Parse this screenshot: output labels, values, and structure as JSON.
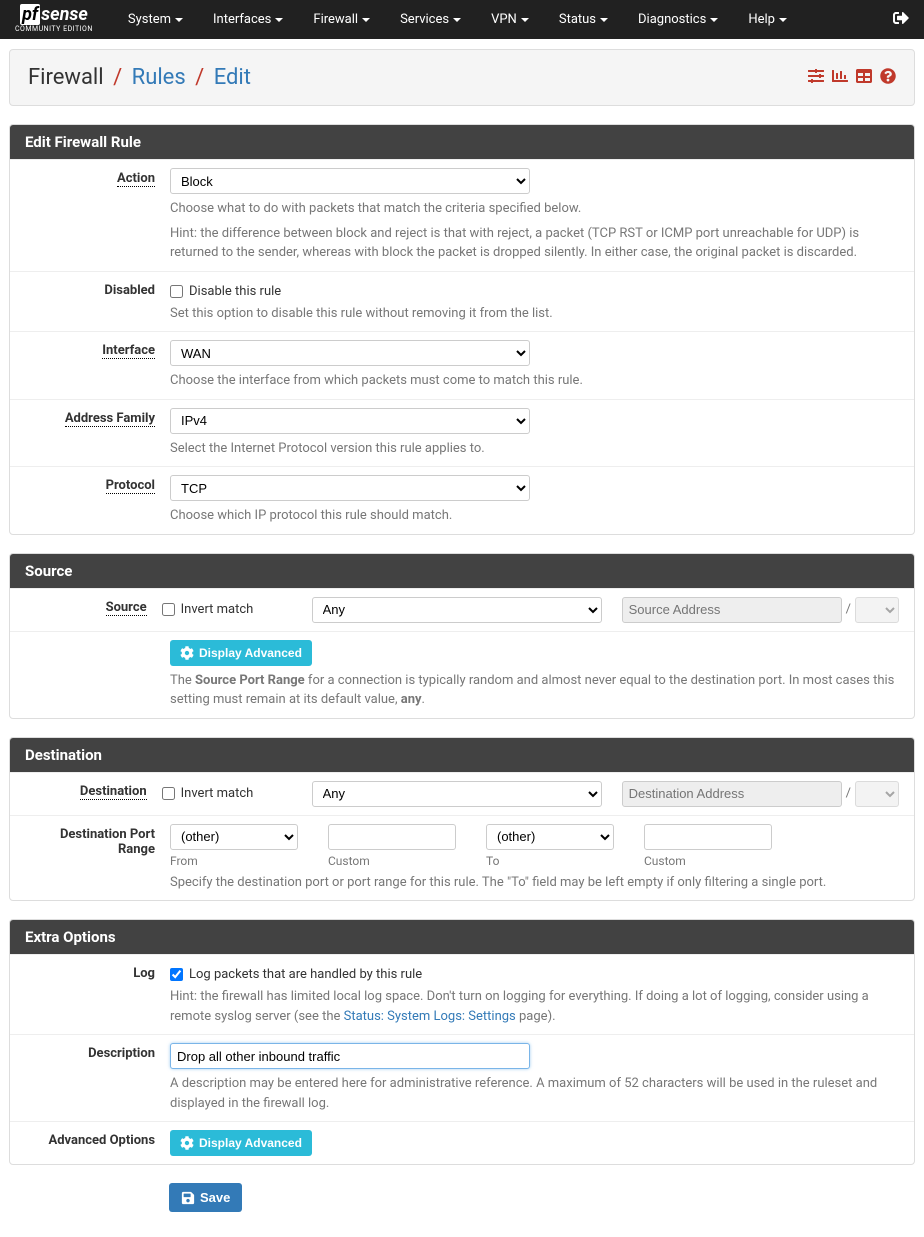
{
  "logo": {
    "brand": "sense",
    "prefix": "pf",
    "tagline": "COMMUNITY EDITION"
  },
  "nav": [
    "System",
    "Interfaces",
    "Firewall",
    "Services",
    "VPN",
    "Status",
    "Diagnostics",
    "Help"
  ],
  "breadcrumb": {
    "root": "Firewall",
    "mid": "Rules",
    "current": "Edit"
  },
  "panels": {
    "edit": {
      "title": "Edit Firewall Rule",
      "action": {
        "label": "Action",
        "value": "Block",
        "help": "Choose what to do with packets that match the criteria specified below.",
        "hint": "Hint: the difference between block and reject is that with reject, a packet (TCP RST or ICMP port unreachable for UDP) is returned to the sender, whereas with block the packet is dropped silently. In either case, the original packet is discarded."
      },
      "disabled": {
        "label": "Disabled",
        "checkbox": "Disable this rule",
        "help": "Set this option to disable this rule without removing it from the list."
      },
      "interface": {
        "label": "Interface",
        "value": "WAN",
        "help": "Choose the interface from which packets must come to match this rule."
      },
      "addrfam": {
        "label": "Address Family",
        "value": "IPv4",
        "help": "Select the Internet Protocol version this rule applies to."
      },
      "protocol": {
        "label": "Protocol",
        "value": "TCP",
        "help": "Choose which IP protocol this rule should match."
      }
    },
    "source": {
      "title": "Source",
      "label": "Source",
      "invert": "Invert match",
      "type": "Any",
      "addr_placeholder": "Source Address",
      "slash": "/",
      "btn": "Display Advanced",
      "help_pre": "The ",
      "help_bold": "Source Port Range",
      "help_post": " for a connection is typically random and almost never equal to the destination port. In most cases this setting must remain at its default value, ",
      "help_any": "any"
    },
    "dest": {
      "title": "Destination",
      "label": "Destination",
      "invert": "Invert match",
      "type": "Any",
      "addr_placeholder": "Destination Address",
      "slash": "/",
      "range_label": "Destination Port Range",
      "from_val": "(other)",
      "to_val": "(other)",
      "sub_from": "From",
      "sub_custom": "Custom",
      "sub_to": "To",
      "help": "Specify the destination port or port range for this rule. The \"To\" field may be left empty if only filtering a single port."
    },
    "extra": {
      "title": "Extra Options",
      "log": {
        "label": "Log",
        "checkbox": "Log packets that are handled by this rule",
        "hint_pre": "Hint: the firewall has limited local log space. Don't turn on logging for everything. If doing a lot of logging, consider using a remote syslog server (see the ",
        "link": "Status: System Logs: Settings",
        "hint_post": " page)."
      },
      "desc": {
        "label": "Description",
        "value": "Drop all other inbound traffic",
        "help": "A description may be entered here for administrative reference. A maximum of 52 characters will be used in the ruleset and displayed in the firewall log."
      },
      "adv": {
        "label": "Advanced Options",
        "btn": "Display Advanced"
      }
    }
  },
  "save": "Save"
}
